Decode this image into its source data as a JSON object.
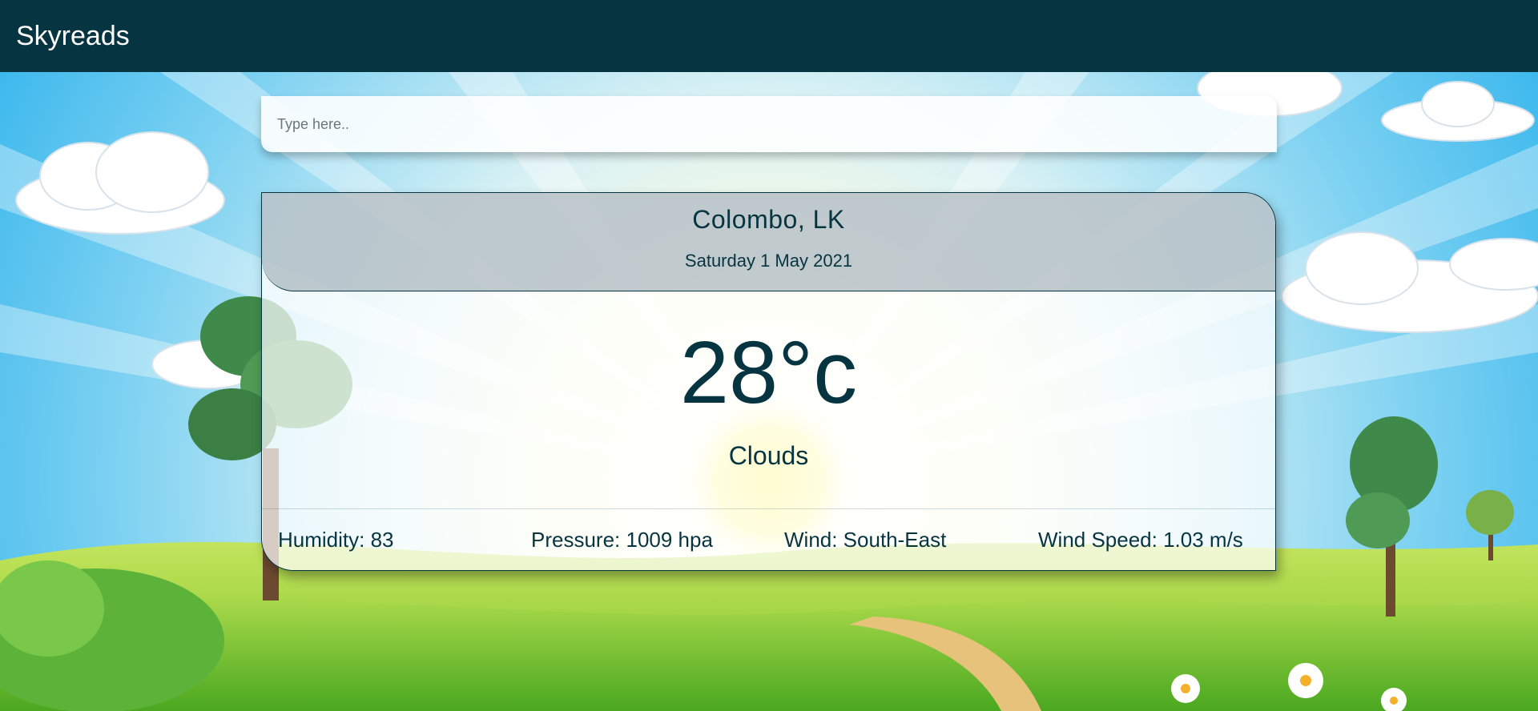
{
  "navbar": {
    "brand": "Skyreads"
  },
  "search": {
    "placeholder": "Type here..",
    "value": ""
  },
  "weather": {
    "location": "Colombo, LK",
    "date": "Saturday 1 May 2021",
    "temperature": "28°c",
    "condition": "Clouds",
    "humidity": "Humidity: 83",
    "pressure": "Pressure: 1009 hpa",
    "wind": "Wind: South-East",
    "wind_speed": "Wind Speed: 1.03 m/s"
  },
  "colors": {
    "navbar_bg": "#073441",
    "text_primary": "#073441",
    "sky": "#5cc3ee",
    "grass": "#8ccd2c"
  }
}
